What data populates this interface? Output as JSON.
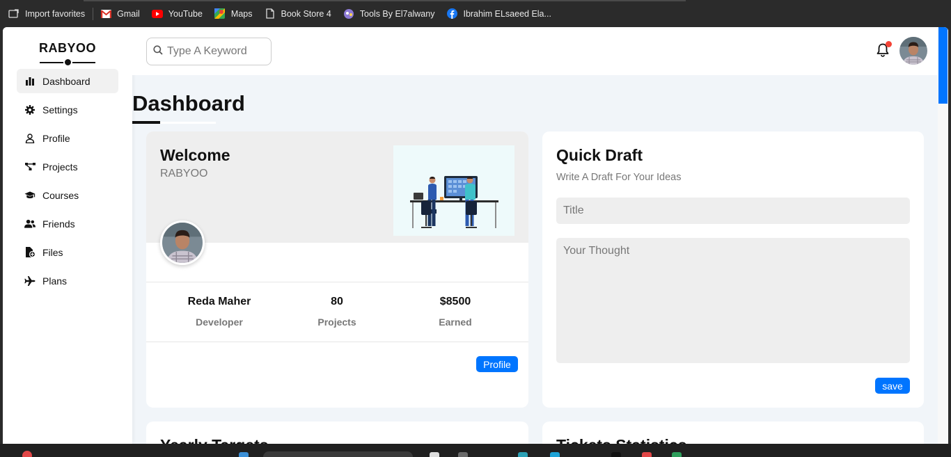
{
  "bookmarks": [
    {
      "label": "Import favorites",
      "icon": "import-icon"
    },
    {
      "label": "Gmail",
      "icon": "gmail-icon"
    },
    {
      "label": "YouTube",
      "icon": "youtube-icon"
    },
    {
      "label": "Maps",
      "icon": "maps-icon"
    },
    {
      "label": "Book Store 4",
      "icon": "page-icon"
    },
    {
      "label": "Tools By El7alwany",
      "icon": "tools-icon"
    },
    {
      "label": "Ibrahim ELsaeed Ela...",
      "icon": "facebook-icon"
    }
  ],
  "sidebar": {
    "logo": "RABYOO",
    "items": [
      {
        "label": "Dashboard",
        "icon": "chart-icon",
        "active": true
      },
      {
        "label": "Settings",
        "icon": "gear-icon"
      },
      {
        "label": "Profile",
        "icon": "user-icon"
      },
      {
        "label": "Projects",
        "icon": "diagram-icon"
      },
      {
        "label": "Courses",
        "icon": "graduation-cap-icon"
      },
      {
        "label": "Friends",
        "icon": "users-icon"
      },
      {
        "label": "Files",
        "icon": "file-icon"
      },
      {
        "label": "Plans",
        "icon": "plane-icon"
      }
    ]
  },
  "header": {
    "search_placeholder": "Type A Keyword",
    "notification_dot_color": "#f44336"
  },
  "page": {
    "title": "Dashboard"
  },
  "welcome": {
    "title": "Welcome",
    "subtitle": "RABYOO",
    "stats": [
      {
        "value": "Reda Maher",
        "label": "Developer"
      },
      {
        "value": "80",
        "label": "Projects"
      },
      {
        "value": "$8500",
        "label": "Earned"
      }
    ],
    "button": "Profile"
  },
  "draft": {
    "title": "Quick Draft",
    "subtitle": "Write A Draft For Your Ideas",
    "title_placeholder": "Title",
    "thought_placeholder": "Your Thought",
    "button": "save"
  },
  "bottom_cards": {
    "left_title": "Yearly Targets",
    "right_title": "Tickets Statistics"
  },
  "colors": {
    "accent": "#0075ff",
    "page_bg": "#f1f5f9"
  }
}
